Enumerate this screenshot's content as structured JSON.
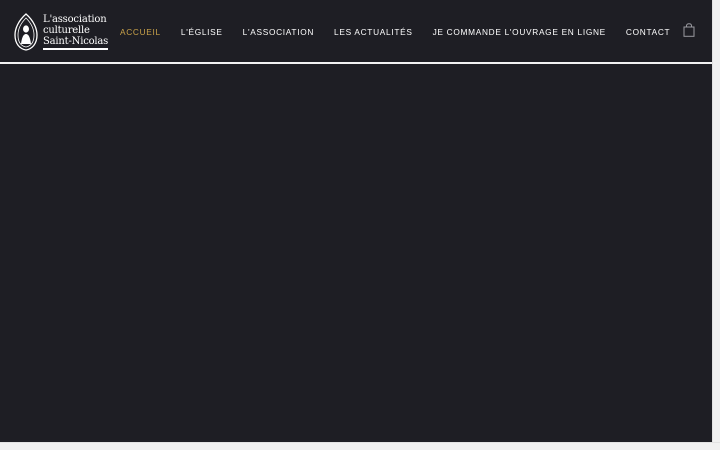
{
  "header": {
    "logo": {
      "lines": [
        "L'association",
        "culturelle",
        "Saint-Nicolas"
      ]
    },
    "nav": [
      {
        "label": "ACCUEIL",
        "active": true
      },
      {
        "label": "L'ÉGLISE",
        "active": false
      },
      {
        "label": "L'ASSOCIATION",
        "active": false
      },
      {
        "label": "LES ACTUALITÉS",
        "active": false
      },
      {
        "label": "JE COMMANDE L'OUVRAGE EN LIGNE",
        "active": false
      },
      {
        "label": "CONTACT",
        "active": false
      }
    ],
    "cart_icon": "shopping-bag-icon"
  },
  "colors": {
    "background": "#1e1e24",
    "accent": "#c9a24a",
    "text": "#ffffff"
  }
}
